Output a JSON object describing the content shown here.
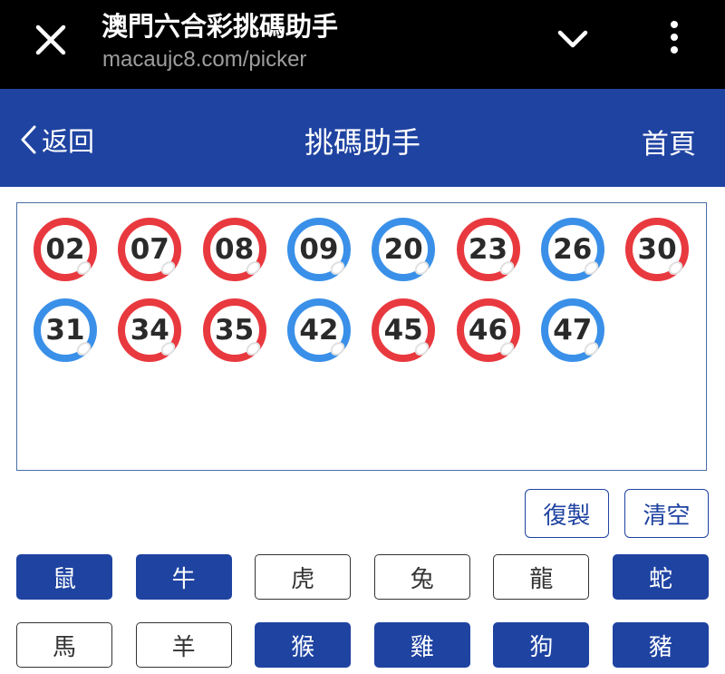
{
  "browser": {
    "title": "澳門六合彩挑碼助手",
    "url": "macaujc8.com/picker"
  },
  "nav": {
    "back_label": "返回",
    "title": "挑碼助手",
    "home_label": "首頁"
  },
  "colors": {
    "primary": "#1f43a1",
    "ball_red": "#e8393f",
    "ball_blue": "#3a90e8"
  },
  "balls": [
    {
      "num": "02",
      "color": "red"
    },
    {
      "num": "07",
      "color": "red"
    },
    {
      "num": "08",
      "color": "red"
    },
    {
      "num": "09",
      "color": "blue"
    },
    {
      "num": "20",
      "color": "blue"
    },
    {
      "num": "23",
      "color": "red"
    },
    {
      "num": "26",
      "color": "blue"
    },
    {
      "num": "30",
      "color": "red"
    },
    {
      "num": "31",
      "color": "blue"
    },
    {
      "num": "34",
      "color": "red"
    },
    {
      "num": "35",
      "color": "red"
    },
    {
      "num": "42",
      "color": "blue"
    },
    {
      "num": "45",
      "color": "red"
    },
    {
      "num": "46",
      "color": "red"
    },
    {
      "num": "47",
      "color": "blue"
    }
  ],
  "actions": {
    "copy_label": "復製",
    "clear_label": "清空"
  },
  "zodiacs": [
    {
      "label": "鼠",
      "selected": true
    },
    {
      "label": "牛",
      "selected": true
    },
    {
      "label": "虎",
      "selected": false
    },
    {
      "label": "兔",
      "selected": false
    },
    {
      "label": "龍",
      "selected": false
    },
    {
      "label": "蛇",
      "selected": true
    },
    {
      "label": "馬",
      "selected": false
    },
    {
      "label": "羊",
      "selected": false
    },
    {
      "label": "猴",
      "selected": true
    },
    {
      "label": "雞",
      "selected": true
    },
    {
      "label": "狗",
      "selected": true
    },
    {
      "label": "豬",
      "selected": true
    }
  ]
}
